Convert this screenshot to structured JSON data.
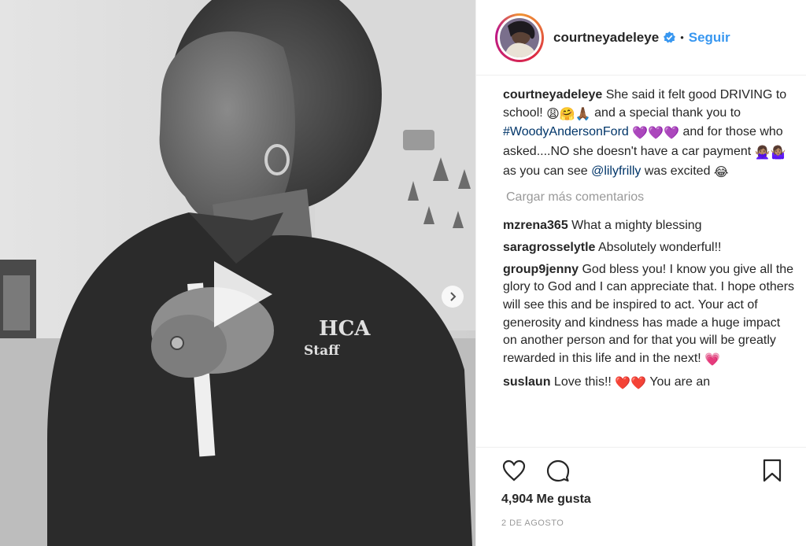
{
  "post": {
    "username": "courtneyadeleye",
    "dot": "•",
    "follow_label": "Seguir",
    "verified": true
  },
  "caption": {
    "username": "courtneyadeleye",
    "text_1": "She said it felt good DRIVING to school!",
    "emoji_1": "😩🤗🙏🏾",
    "text_2": "and a special thank you to",
    "hashtag": "#WoodyAndersonFord",
    "emoji_2": "💜💜💜",
    "text_3": "and for those who asked....NO she doesn't have a car payment",
    "emoji_3": "🙅🏽‍♀️🤷🏽‍♀️",
    "text_4": "as you can see",
    "mention": "@lilyfrilly",
    "text_5": "was excited",
    "emoji_4": "😂"
  },
  "load_more_label": "Cargar más comentarios",
  "comments": [
    {
      "user": "mzrena365",
      "text": "What a mighty blessing"
    },
    {
      "user": "saragrosselytle",
      "text": "Absolutely wonderful!!"
    },
    {
      "user": "group9jenny",
      "text": "God bless you! I know you give all the glory to God and I can appreciate that. I hope others will see this and be inspired to act. Your act of generosity and kindness has made a huge impact on another person and for that you will be greatly rewarded in this life and in the next!",
      "emoji": "💗"
    },
    {
      "user": "suslaun",
      "text": "Love this!!",
      "emoji": "❤️❤️",
      "text_after": "You are an"
    }
  ],
  "likes_text": "4,904 Me gusta",
  "date_text": "2 DE AGOSTO",
  "icons": {
    "like": "heart-icon",
    "comment": "comment-icon",
    "save": "bookmark-icon",
    "play": "play-icon",
    "next": "chevron-right-icon",
    "verified": "verified-badge-icon"
  },
  "colors": {
    "link": "#003569",
    "follow": "#3897f0",
    "muted": "#999999",
    "verified": "#3897f0"
  },
  "media": {
    "shirt_logo_text": "HCA",
    "shirt_sub_text": "Staff"
  }
}
